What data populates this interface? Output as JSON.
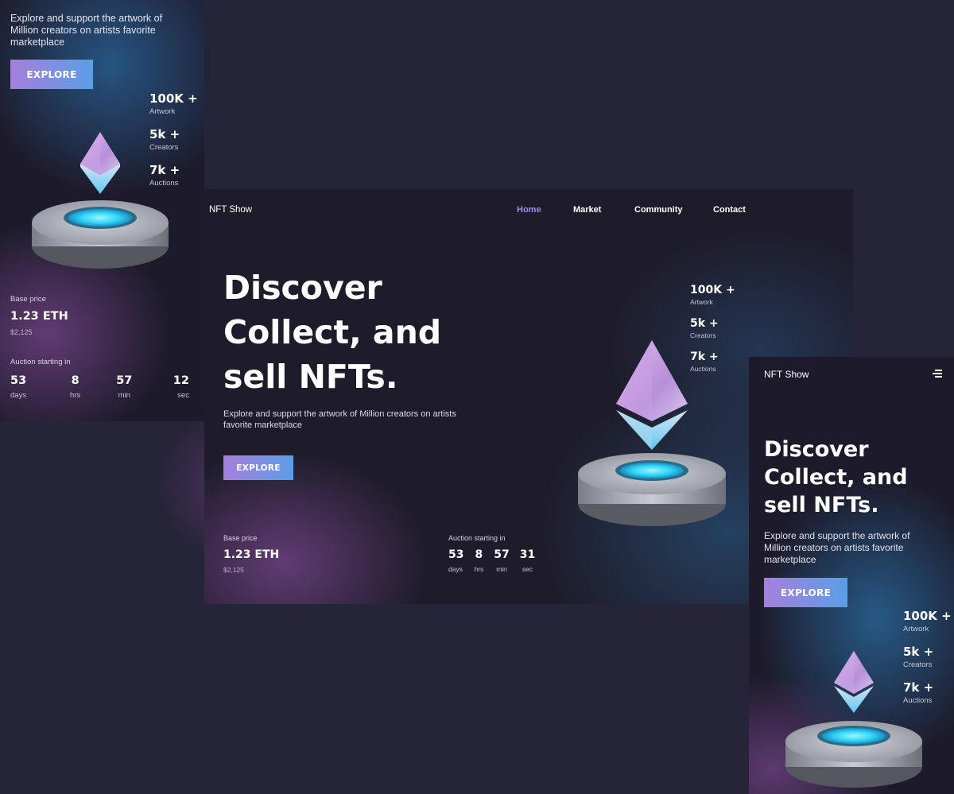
{
  "brand": "NFT Show",
  "nav": [
    {
      "label": "Home",
      "active": true
    },
    {
      "label": "Market",
      "active": false
    },
    {
      "label": "Community",
      "active": false
    },
    {
      "label": "Contact",
      "active": false
    }
  ],
  "hero": {
    "title_highlight": "Discover",
    "title_line2": "Collect, and",
    "title_line3": "sell NFTs.",
    "description": "Explore and support the artwork of Million creators on artists favorite marketplace",
    "explore_label": "EXPLORE"
  },
  "stats": [
    {
      "value": "100K +",
      "label": "Artwork"
    },
    {
      "value": "5k +",
      "label": "Creators"
    },
    {
      "value": "7k +",
      "label": "Auctions"
    }
  ],
  "price": {
    "label": "Base price",
    "eth": "1.23 ETH",
    "usd": "$2,125"
  },
  "auction": {
    "label": "Auction starting in",
    "desktop": [
      {
        "value": "53",
        "unit": "days"
      },
      {
        "value": "8",
        "unit": "hrs"
      },
      {
        "value": "57",
        "unit": "min"
      },
      {
        "value": "31",
        "unit": "sec"
      }
    ],
    "mobile": [
      {
        "value": "53",
        "unit": "days"
      },
      {
        "value": "8",
        "unit": "hrs"
      },
      {
        "value": "57",
        "unit": "min"
      },
      {
        "value": "12",
        "unit": "sec"
      }
    ]
  },
  "icons": {
    "menu": "menu-icon",
    "artwork": "ethereum-pedestal-icon"
  },
  "colors": {
    "background": "#262438",
    "accent_start": "#a67fdc",
    "accent_end": "#5b9ee6",
    "nav_active": "#9e8ee8"
  }
}
